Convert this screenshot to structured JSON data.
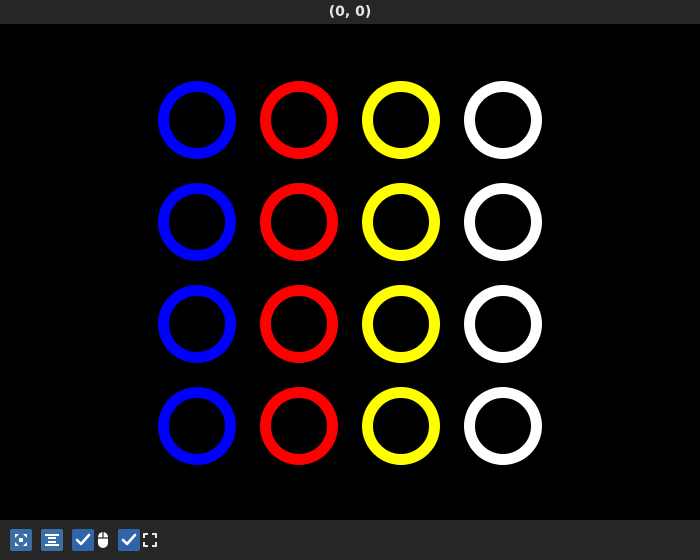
{
  "window": {
    "title": "(0, 0)"
  },
  "canvas": {
    "background": "#000000",
    "ring_colors": [
      "#0000ff",
      "#ff0000",
      "#ffff00",
      "#ffffff"
    ],
    "rows": 4,
    "columns": 4
  },
  "toolbar": {
    "items": [
      {
        "icon": "fit-view-icon",
        "kind": "button"
      },
      {
        "icon": "align-center-icon",
        "kind": "button"
      },
      {
        "icon": "checkbox-checked-icon",
        "kind": "checkbox",
        "checked": true
      },
      {
        "icon": "mouse-icon",
        "kind": "label"
      },
      {
        "icon": "checkbox-checked-icon",
        "kind": "checkbox",
        "checked": true
      },
      {
        "icon": "fullscreen-icon",
        "kind": "label"
      }
    ]
  }
}
